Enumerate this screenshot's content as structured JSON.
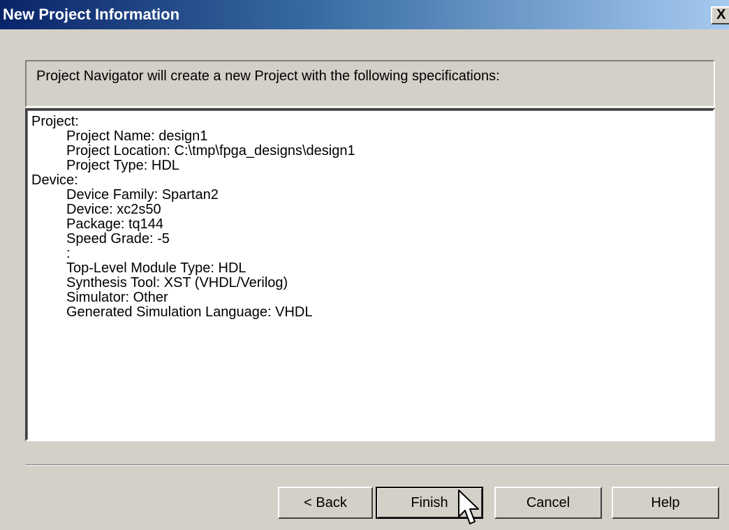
{
  "window": {
    "title": "New Project Information",
    "close_label": "X"
  },
  "info": {
    "text": "Project Navigator will create a new Project with the following specifications:"
  },
  "spec": {
    "lines": [
      {
        "text": "Project:",
        "indent": false
      },
      {
        "text": "Project Name: design1",
        "indent": true
      },
      {
        "text": "Project Location: C:\\tmp\\fpga_designs\\design1",
        "indent": true
      },
      {
        "text": "Project Type: HDL",
        "indent": true
      },
      {
        "text": "Device:",
        "indent": false
      },
      {
        "text": "Device Family: Spartan2",
        "indent": true
      },
      {
        "text": "Device: xc2s50",
        "indent": true
      },
      {
        "text": "Package: tq144",
        "indent": true
      },
      {
        "text": "Speed Grade: -5",
        "indent": true
      },
      {
        "text": ":",
        "indent": true
      },
      {
        "text": "Top-Level Module Type: HDL",
        "indent": true
      },
      {
        "text": "Synthesis Tool: XST (VHDL/Verilog)",
        "indent": true
      },
      {
        "text": "Simulator: Other",
        "indent": true
      },
      {
        "text": "Generated Simulation Language: VHDL",
        "indent": true
      }
    ]
  },
  "buttons": {
    "back": "< Back",
    "finish": "Finish",
    "cancel": "Cancel",
    "help": "Help"
  },
  "icons": {
    "close": "close-icon",
    "cursor": "mouse-pointer-icon"
  }
}
